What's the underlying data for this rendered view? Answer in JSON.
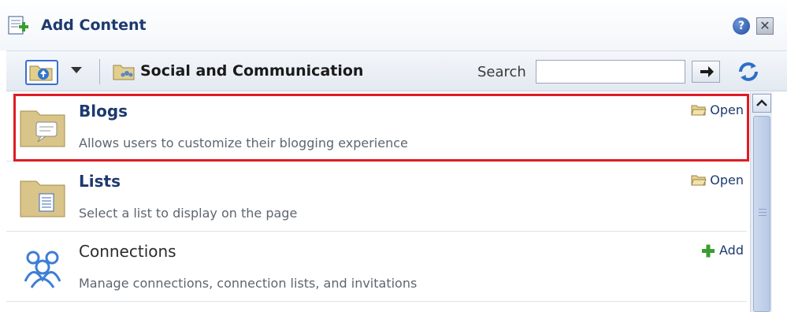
{
  "header": {
    "title": "Add Content",
    "help_label": "?",
    "close_label": "✕"
  },
  "toolbar": {
    "breadcrumb": "Social and Communication",
    "search_label": "Search",
    "search_value": ""
  },
  "items": [
    {
      "title": "Blogs",
      "description": "Allows users to customize their blogging experience",
      "action": "Open",
      "icon": "chat-folder-icon",
      "selected": true
    },
    {
      "title": "Lists",
      "description": "Select a list to display on the page",
      "action": "Open",
      "icon": "list-folder-icon",
      "selected": false
    },
    {
      "title": "Connections",
      "description": "Manage connections, connection lists, and invitations",
      "action": "Add",
      "icon": "people-icon",
      "selected": false
    }
  ],
  "colors": {
    "accent": "#1d3a6e",
    "highlight": "#e01b24",
    "folder": "#d9c58a"
  }
}
